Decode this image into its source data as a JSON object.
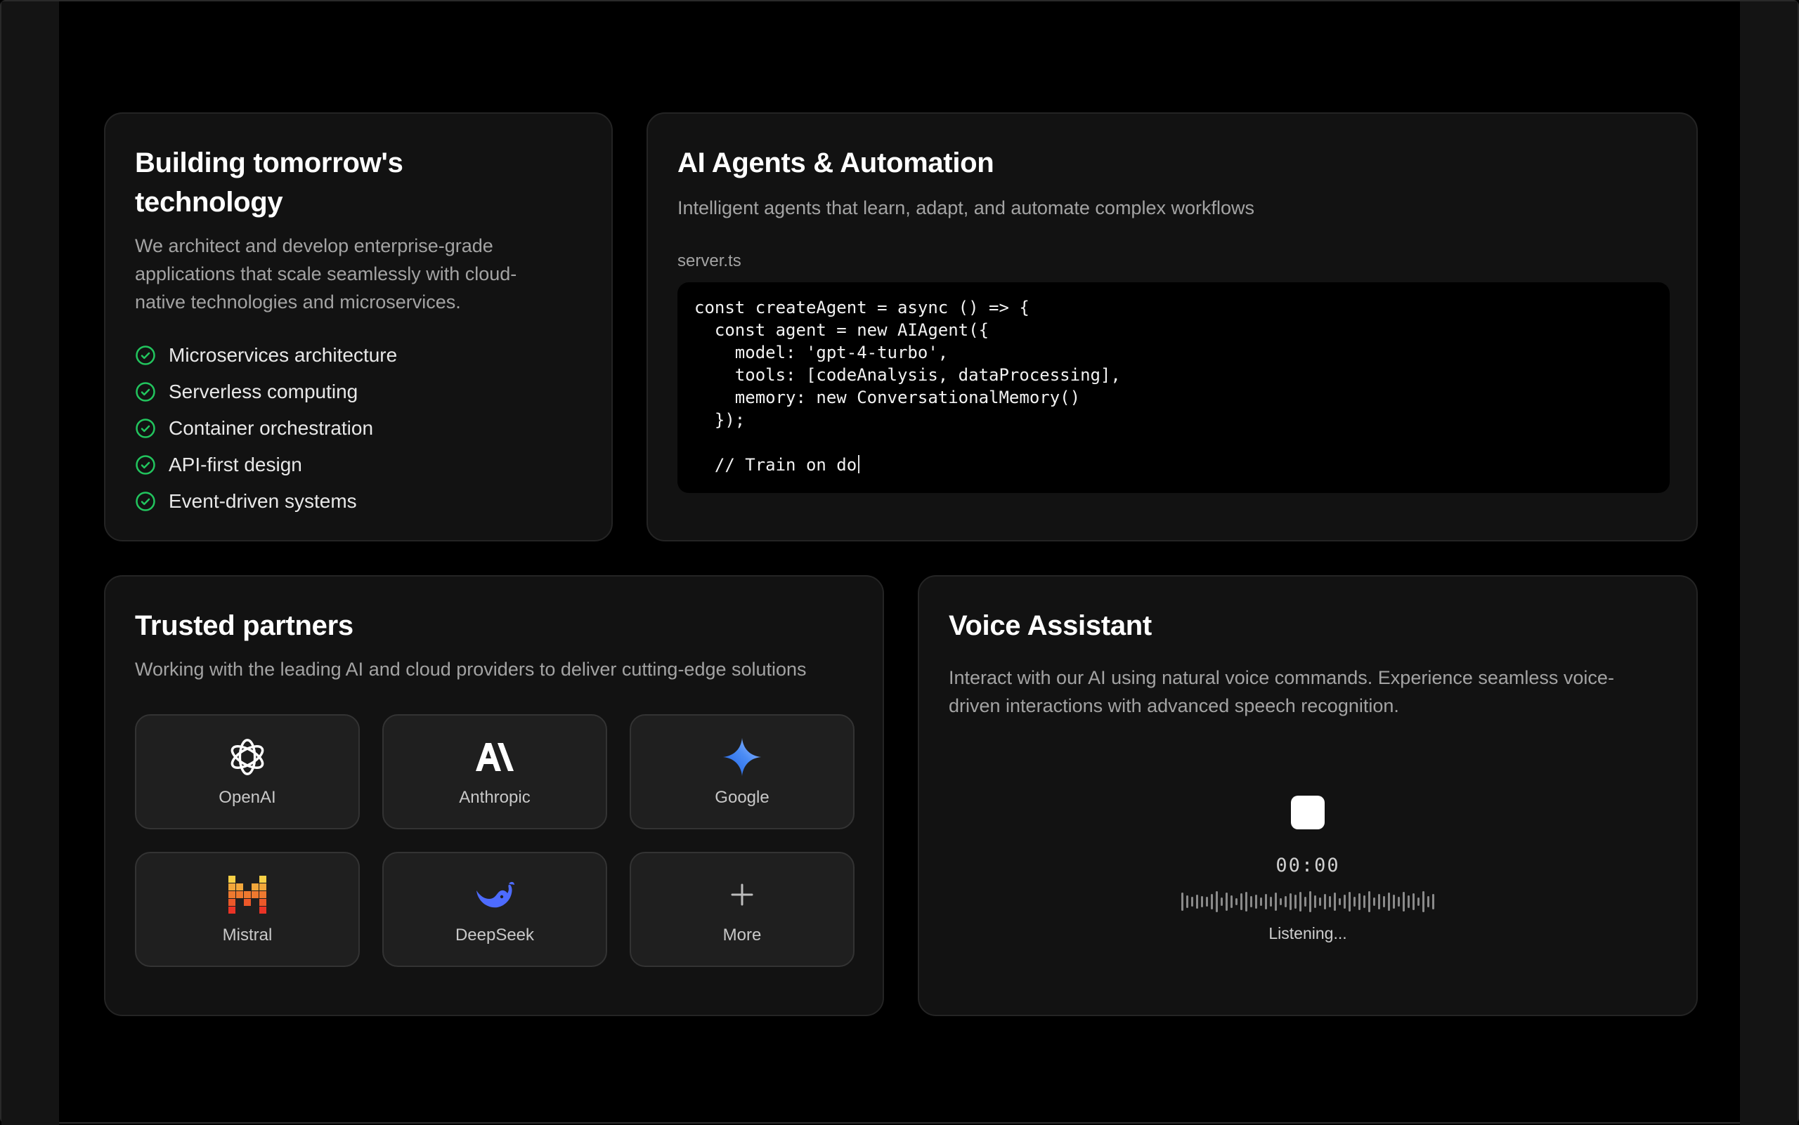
{
  "tech_card": {
    "title": "Building tomorrow's technology",
    "description": "We architect and develop enterprise-grade applications that scale seamlessly with cloud-native technologies and microservices.",
    "features": [
      "Microservices architecture",
      "Serverless computing",
      "Container orchestration",
      "API-first design",
      "Event-driven systems"
    ],
    "check_color": "#22c55e"
  },
  "agents_card": {
    "title": "AI Agents & Automation",
    "description": "Intelligent agents that learn, adapt, and automate complex workflows",
    "filename": "server.ts",
    "code_lines": [
      "const createAgent = async () => {",
      "  const agent = new AIAgent({",
      "    model: 'gpt-4-turbo',",
      "    tools: [codeAnalysis, dataProcessing],",
      "    memory: new ConversationalMemory()",
      "  });",
      "",
      "  // Train on do"
    ]
  },
  "partners_card": {
    "title": "Trusted partners",
    "description": "Working with the leading AI and cloud providers to deliver cutting-edge solutions",
    "partners": [
      {
        "name": "OpenAI",
        "icon": "openai-icon"
      },
      {
        "name": "Anthropic",
        "icon": "anthropic-icon"
      },
      {
        "name": "Google",
        "icon": "google-gemini-icon"
      },
      {
        "name": "Mistral",
        "icon": "mistral-icon"
      },
      {
        "name": "DeepSeek",
        "icon": "deepseek-icon"
      },
      {
        "name": "More",
        "icon": "plus-icon"
      }
    ]
  },
  "voice_card": {
    "title": "Voice Assistant",
    "description": "Interact with our AI using natural voice commands. Experience seamless voice-driven interactions with advanced speech recognition.",
    "timer": "00:00",
    "status": "Listening..."
  }
}
